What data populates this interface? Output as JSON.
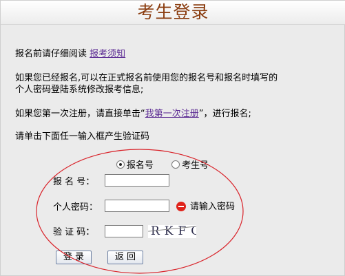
{
  "header": {
    "title": "考生登录"
  },
  "intro": {
    "read_prefix": "报名前请仔细阅读",
    "read_link": "报考须知",
    "existing_line1": "如果您已经报名,可以在正式报名前使用您的报名号和报名时填写的",
    "existing_line2": "个人密码登陆系统修改报考信息;",
    "first_prefix": "如果您第一次注册，请直接单击“",
    "first_link": "我第一次注册",
    "first_suffix": "”，进行报名;",
    "captcha_hint": "请单击下面任一输入框产生验证码"
  },
  "login": {
    "radio_options": [
      {
        "label": "报名号",
        "checked": true
      },
      {
        "label": "考生号",
        "checked": false
      }
    ],
    "reg_label": "报 名 号：",
    "reg_value": "",
    "password_label": "个人密码：",
    "password_value": "",
    "password_error": "请输入密码",
    "captcha_label": "验 证 码：",
    "captcha_value": "",
    "captcha_text": "RKFG",
    "login_button": "登 录",
    "back_button": "返 回"
  },
  "colors": {
    "title": "#8a3c0f",
    "link": "#5b2a93",
    "error": "#e0231b",
    "oval": "#d9232a"
  }
}
